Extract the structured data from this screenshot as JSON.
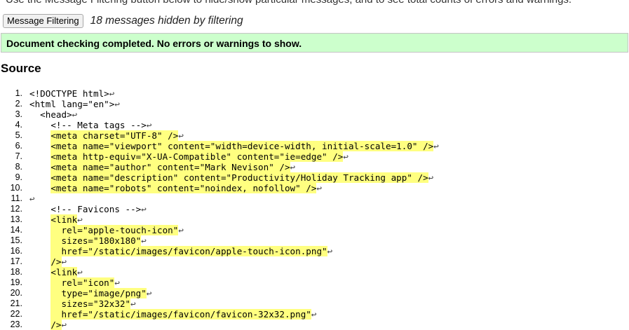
{
  "intro_text": "Use the Message Filtering button below to hide/show particular messages, and to see total counts of errors and warnings.",
  "filter_button_label": "Message Filtering",
  "hidden_messages_text": "18 messages hidden by filtering",
  "status_banner": "Document checking completed. No errors or warnings to show.",
  "colors": {
    "banner_bg": "#ccffcc",
    "highlight": "#ffff80"
  },
  "source": {
    "heading": "Source",
    "eol_marker": "↩",
    "lines": [
      {
        "num": "1.",
        "indent": "",
        "text": "<!DOCTYPE html>",
        "highlight": false
      },
      {
        "num": "2.",
        "indent": "",
        "text": "<html lang=\"en\">",
        "highlight": false
      },
      {
        "num": "3.",
        "indent": "  ",
        "text": "<head>",
        "highlight": false
      },
      {
        "num": "4.",
        "indent": "    ",
        "text": "<!-- Meta tags -->",
        "highlight": false
      },
      {
        "num": "5.",
        "indent": "    ",
        "text": "<meta charset=\"UTF-8\" />",
        "highlight": true
      },
      {
        "num": "6.",
        "indent": "    ",
        "text": "<meta name=\"viewport\" content=\"width=device-width, initial-scale=1.0\" />",
        "highlight": true
      },
      {
        "num": "7.",
        "indent": "    ",
        "text": "<meta http-equiv=\"X-UA-Compatible\" content=\"ie=edge\" />",
        "highlight": true
      },
      {
        "num": "8.",
        "indent": "    ",
        "text": "<meta name=\"author\" content=\"Mark Nevison\" />",
        "highlight": true
      },
      {
        "num": "9.",
        "indent": "    ",
        "text": "<meta name=\"description\" content=\"Productivity/Holiday Tracking app\" />",
        "highlight": true
      },
      {
        "num": "10.",
        "indent": "    ",
        "text": "<meta name=\"robots\" content=\"noindex, nofollow\" />",
        "highlight": true
      },
      {
        "num": "11.",
        "indent": "",
        "text": "",
        "highlight": false
      },
      {
        "num": "12.",
        "indent": "    ",
        "text": "<!-- Favicons -->",
        "highlight": false
      },
      {
        "num": "13.",
        "indent": "    ",
        "text": "<link",
        "highlight": true
      },
      {
        "num": "14.",
        "indent": "    ",
        "text": "  rel=\"apple-touch-icon\"",
        "highlight": true
      },
      {
        "num": "15.",
        "indent": "    ",
        "text": "  sizes=\"180x180\"",
        "highlight": true
      },
      {
        "num": "16.",
        "indent": "    ",
        "text": "  href=\"/static/images/favicon/apple-touch-icon.png\"",
        "highlight": true
      },
      {
        "num": "17.",
        "indent": "    ",
        "text": "/>",
        "highlight": true
      },
      {
        "num": "18.",
        "indent": "    ",
        "text": "<link",
        "highlight": true
      },
      {
        "num": "19.",
        "indent": "    ",
        "text": "  rel=\"icon\"",
        "highlight": true
      },
      {
        "num": "20.",
        "indent": "    ",
        "text": "  type=\"image/png\"",
        "highlight": true
      },
      {
        "num": "21.",
        "indent": "    ",
        "text": "  sizes=\"32x32\"",
        "highlight": true
      },
      {
        "num": "22.",
        "indent": "    ",
        "text": "  href=\"/static/images/favicon/favicon-32x32.png\"",
        "highlight": true
      },
      {
        "num": "23.",
        "indent": "    ",
        "text": "/>",
        "highlight": true
      }
    ]
  }
}
